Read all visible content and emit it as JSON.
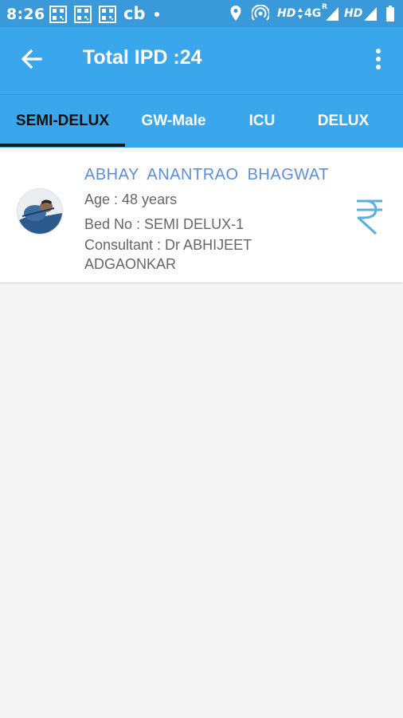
{
  "status_bar": {
    "time": "8:26",
    "carrier_text": "cb",
    "network_1": "HD",
    "network_2": "4G",
    "network_2_roaming": "R",
    "network_3": "HD"
  },
  "header": {
    "title": "Total IPD :24",
    "background_color": "#3aa6ec"
  },
  "tabs": [
    {
      "label": "SEMI-DELUX",
      "active": true
    },
    {
      "label": "GW-Male",
      "active": false
    },
    {
      "label": "ICU",
      "active": false
    },
    {
      "label": "DELUX",
      "active": false
    }
  ],
  "patient": {
    "name": "ABHAY  ANANTRAO  BHAGWAT",
    "age": "Age : 48 years",
    "bed": "Bed No : SEMI DELUX-1",
    "consultant_line1": "Consultant : Dr ABHIJEET",
    "consultant_line2": "ADGAONKAR",
    "billing_icon": "rupee-icon"
  }
}
